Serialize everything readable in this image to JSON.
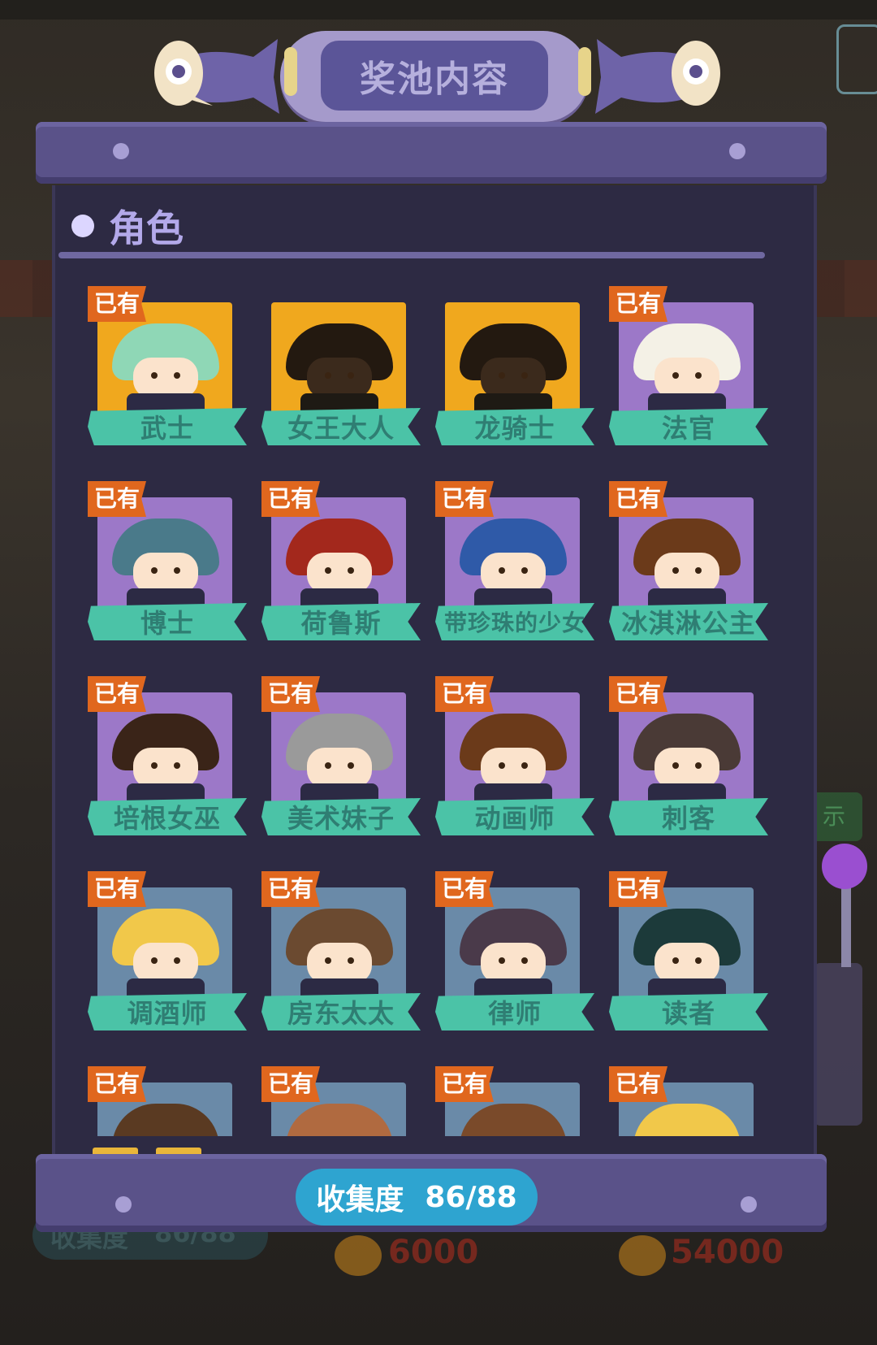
{
  "banner": {
    "title": "奖池内容"
  },
  "section": {
    "title": "角色"
  },
  "owned_label": "已有",
  "characters": [
    {
      "name": "武士",
      "owned": true,
      "rarity": "gold",
      "hair": "#8fd7b6"
    },
    {
      "name": "女王大人",
      "owned": false,
      "rarity": "gold",
      "hair": "#3a2a1a"
    },
    {
      "name": "龙骑士",
      "owned": false,
      "rarity": "gold",
      "hair": "#3a2a1a"
    },
    {
      "name": "法官",
      "owned": true,
      "rarity": "purple",
      "hair": "#f4f1e6"
    },
    {
      "name": "博士",
      "owned": true,
      "rarity": "purple",
      "hair": "#4a7a8a"
    },
    {
      "name": "荷鲁斯",
      "owned": true,
      "rarity": "purple",
      "hair": "#a3281c"
    },
    {
      "name": "带珍珠的少女",
      "owned": true,
      "rarity": "purple",
      "hair": "#2f5aa8"
    },
    {
      "name": "冰淇淋公主",
      "owned": true,
      "rarity": "purple",
      "hair": "#6b3a1a"
    },
    {
      "name": "培根女巫",
      "owned": true,
      "rarity": "purple",
      "hair": "#3a2418"
    },
    {
      "name": "美术妹子",
      "owned": true,
      "rarity": "purple",
      "hair": "#9a9a9a"
    },
    {
      "name": "动画师",
      "owned": true,
      "rarity": "purple",
      "hair": "#6b3a1a"
    },
    {
      "name": "刺客",
      "owned": true,
      "rarity": "purple",
      "hair": "#4a3a36"
    },
    {
      "name": "调酒师",
      "owned": true,
      "rarity": "blue",
      "hair": "#f1c84a"
    },
    {
      "name": "房东太太",
      "owned": true,
      "rarity": "blue",
      "hair": "#6b4a30"
    },
    {
      "name": "律师",
      "owned": true,
      "rarity": "blue",
      "hair": "#4a3a4a"
    },
    {
      "name": "读者",
      "owned": true,
      "rarity": "blue",
      "hair": "#1c3a3a"
    },
    {
      "name": "",
      "owned": true,
      "rarity": "blue",
      "hair": "#5a3a22"
    },
    {
      "name": "",
      "owned": true,
      "rarity": "blue",
      "hair": "#b06a40"
    },
    {
      "name": "",
      "owned": true,
      "rarity": "blue",
      "hair": "#7a4a2a"
    },
    {
      "name": "",
      "owned": true,
      "rarity": "blue",
      "hair": "#f1c84a"
    }
  ],
  "collection": {
    "label": "收集度",
    "value": "86/88"
  },
  "background": {
    "counter_label": "收集度",
    "counter_value": "86/88",
    "coins_a": "6000",
    "coins_b": "54000",
    "side_button": "示"
  },
  "colors": {
    "gold": "#f0a81e",
    "purple": "#9c78c8",
    "blue": "#6a8aa8",
    "badge": "#e0671e",
    "ribbon": "#4bc3a7"
  }
}
